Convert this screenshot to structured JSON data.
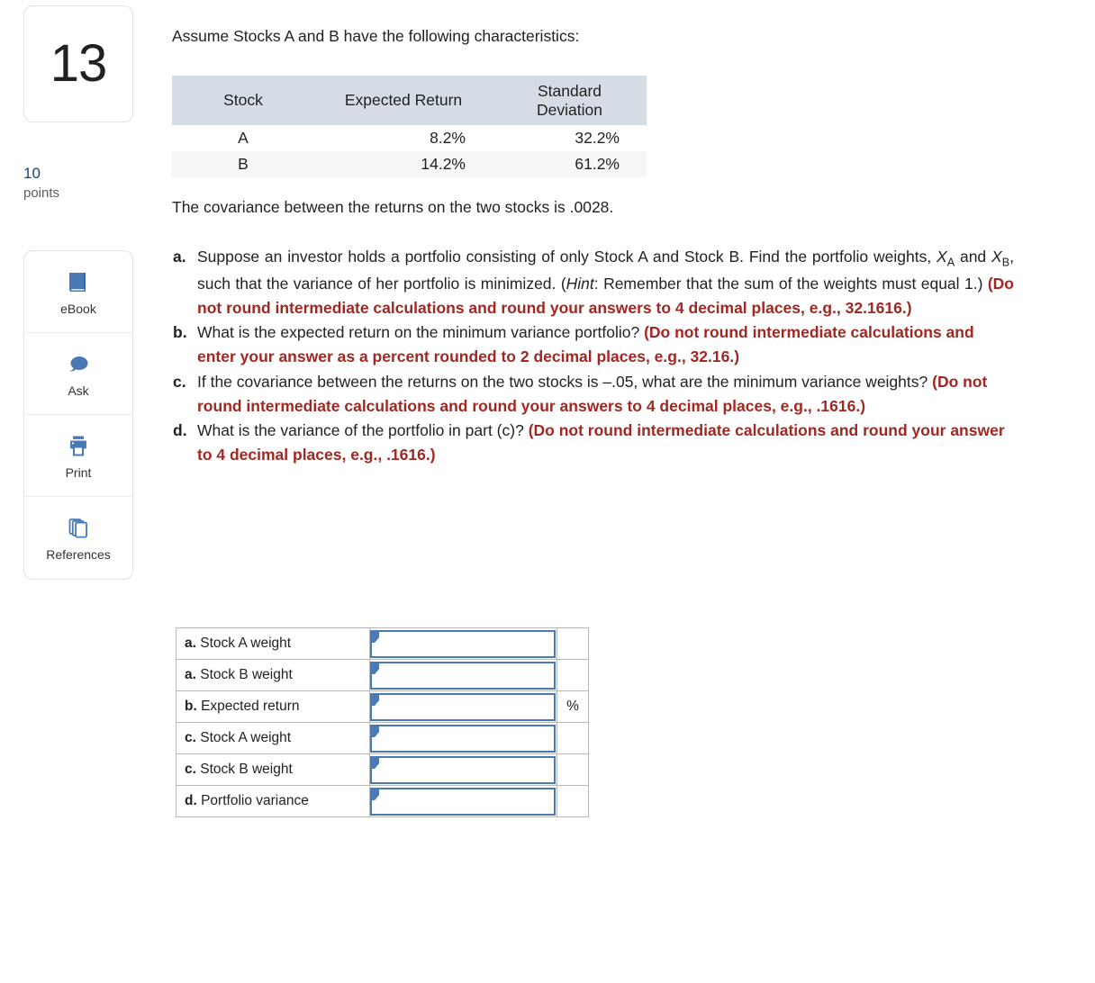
{
  "left_rail": {
    "question_number": "13",
    "points_value": "10",
    "points_label": "points",
    "tools": [
      {
        "label": "eBook",
        "icon": "book-icon"
      },
      {
        "label": "Ask",
        "icon": "speech-bubble-icon"
      },
      {
        "label": "Print",
        "icon": "printer-icon"
      },
      {
        "label": "References",
        "icon": "copy-pages-icon"
      }
    ]
  },
  "content": {
    "intro": "Assume Stocks A and B have the following characteristics:",
    "covariance_statement": "The covariance between the returns on the two stocks is .0028."
  },
  "stock_table": {
    "headers": {
      "stock": "Stock",
      "expected_return": "Expected Return",
      "standard_deviation_line1": "Standard",
      "standard_deviation_line2": "Deviation"
    },
    "rows": [
      {
        "stock": "A",
        "expected_return": "8.2%",
        "standard_deviation": "32.2%"
      },
      {
        "stock": "B",
        "expected_return": "14.2%",
        "standard_deviation": "61.2%"
      }
    ]
  },
  "parts": {
    "a": {
      "letter": "a.",
      "text_1": "Suppose an investor holds a portfolio consisting of only Stock A and Stock B. Find the portfolio weights,",
      "var_1_base": "X",
      "var_1_sub": "A",
      "text_2": "and",
      "var_2_base": "X",
      "var_2_sub": "B",
      "text_3": ", such that the variance of her portfolio is minimized. (",
      "hint_word": "Hint",
      "text_4": ": Remember that the sum of the weights must equal 1.)",
      "red_note": "(Do not round intermediate calculations and round your answers to 4 decimal places, e.g., 32.1616.)"
    },
    "b": {
      "letter": "b.",
      "text": "What is the expected return on the minimum variance portfolio?",
      "red_note": "(Do not round intermediate calculations and enter your answer as a percent rounded to 2 decimal places, e.g., 32.16.)"
    },
    "c": {
      "letter": "c.",
      "text": "If the covariance between the returns on the two stocks is –.05, what are the minimum variance weights?",
      "red_note": "(Do not round intermediate calculations and round your answers to 4 decimal places, e.g., .1616.)"
    },
    "d": {
      "letter": "d.",
      "text": "What is the variance of the portfolio in part (c)?",
      "red_note": "(Do not round intermediate calculations and round your answer to 4 decimal places, e.g., .1616.)"
    }
  },
  "answer_table": {
    "rows": [
      {
        "prefix": "a.",
        "label": " Stock A weight",
        "value": "",
        "unit": ""
      },
      {
        "prefix": "a.",
        "label": " Stock B weight",
        "value": "",
        "unit": ""
      },
      {
        "prefix": "b.",
        "label": " Expected return",
        "value": "",
        "unit": "%"
      },
      {
        "prefix": "c.",
        "label": " Stock A weight",
        "value": "",
        "unit": ""
      },
      {
        "prefix": "c.",
        "label": " Stock B weight",
        "value": "",
        "unit": ""
      },
      {
        "prefix": "d.",
        "label": " Portfolio variance",
        "value": "",
        "unit": ""
      }
    ]
  },
  "colors": {
    "accent_red": "#a02823",
    "accent_blue": "#4a7ab5",
    "points_blue": "#1b4079",
    "table_header_bg": "#d6dce5",
    "table_alt_row_bg": "#f6f6f6"
  }
}
